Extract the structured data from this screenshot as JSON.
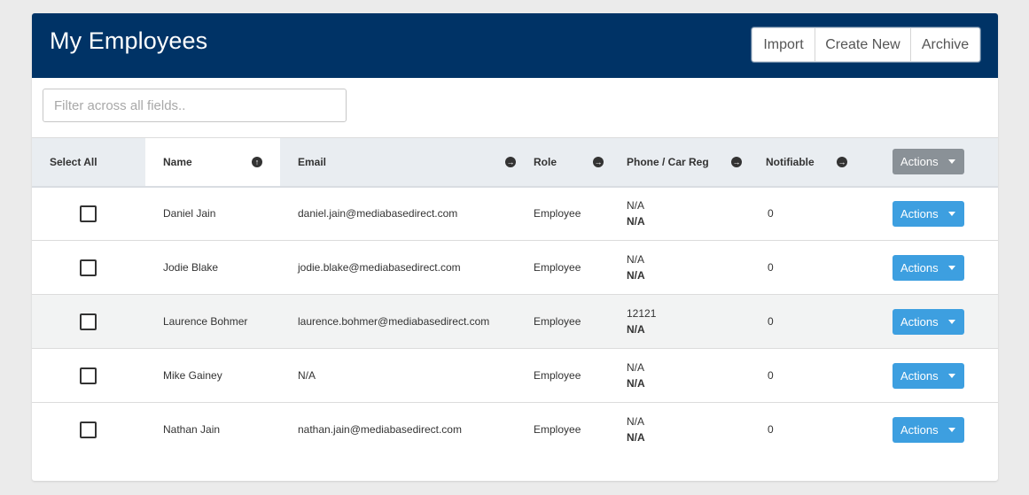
{
  "header": {
    "title": "My Employees",
    "buttons": {
      "import": "Import",
      "create_new": "Create New",
      "archive": "Archive"
    }
  },
  "filter": {
    "placeholder": "Filter across all fields.."
  },
  "table": {
    "columns": {
      "select_all": "Select All",
      "name": "Name",
      "email": "Email",
      "role": "Role",
      "phone": "Phone / Car Reg",
      "notifiable": "Notifiable",
      "actions": "Actions"
    },
    "sort_icons": {
      "name": "sort-up-icon",
      "others": "sort-right-icon"
    },
    "rows": [
      {
        "name": "Daniel Jain",
        "email": "daniel.jain@mediabasedirect.com",
        "role": "Employee",
        "phone": "N/A",
        "car_reg": "N/A",
        "notifiable": "0",
        "actions": "Actions"
      },
      {
        "name": "Jodie Blake",
        "email": "jodie.blake@mediabasedirect.com",
        "role": "Employee",
        "phone": "N/A",
        "car_reg": "N/A",
        "notifiable": "0",
        "actions": "Actions"
      },
      {
        "name": "Laurence Bohmer",
        "email": "laurence.bohmer@mediabasedirect.com",
        "role": "Employee",
        "phone": "12121",
        "car_reg": "N/A",
        "notifiable": "0",
        "actions": "Actions"
      },
      {
        "name": "Mike Gainey",
        "email": "N/A",
        "role": "Employee",
        "phone": "N/A",
        "car_reg": "N/A",
        "notifiable": "0",
        "actions": "Actions"
      },
      {
        "name": "Nathan Jain",
        "email": "nathan.jain@mediabasedirect.com",
        "role": "Employee",
        "phone": "N/A",
        "car_reg": "N/A",
        "notifiable": "0",
        "actions": "Actions"
      }
    ]
  },
  "colors": {
    "header_bg": "#003366",
    "action_blue": "#3d9fe0",
    "action_grey": "#8a9197"
  }
}
